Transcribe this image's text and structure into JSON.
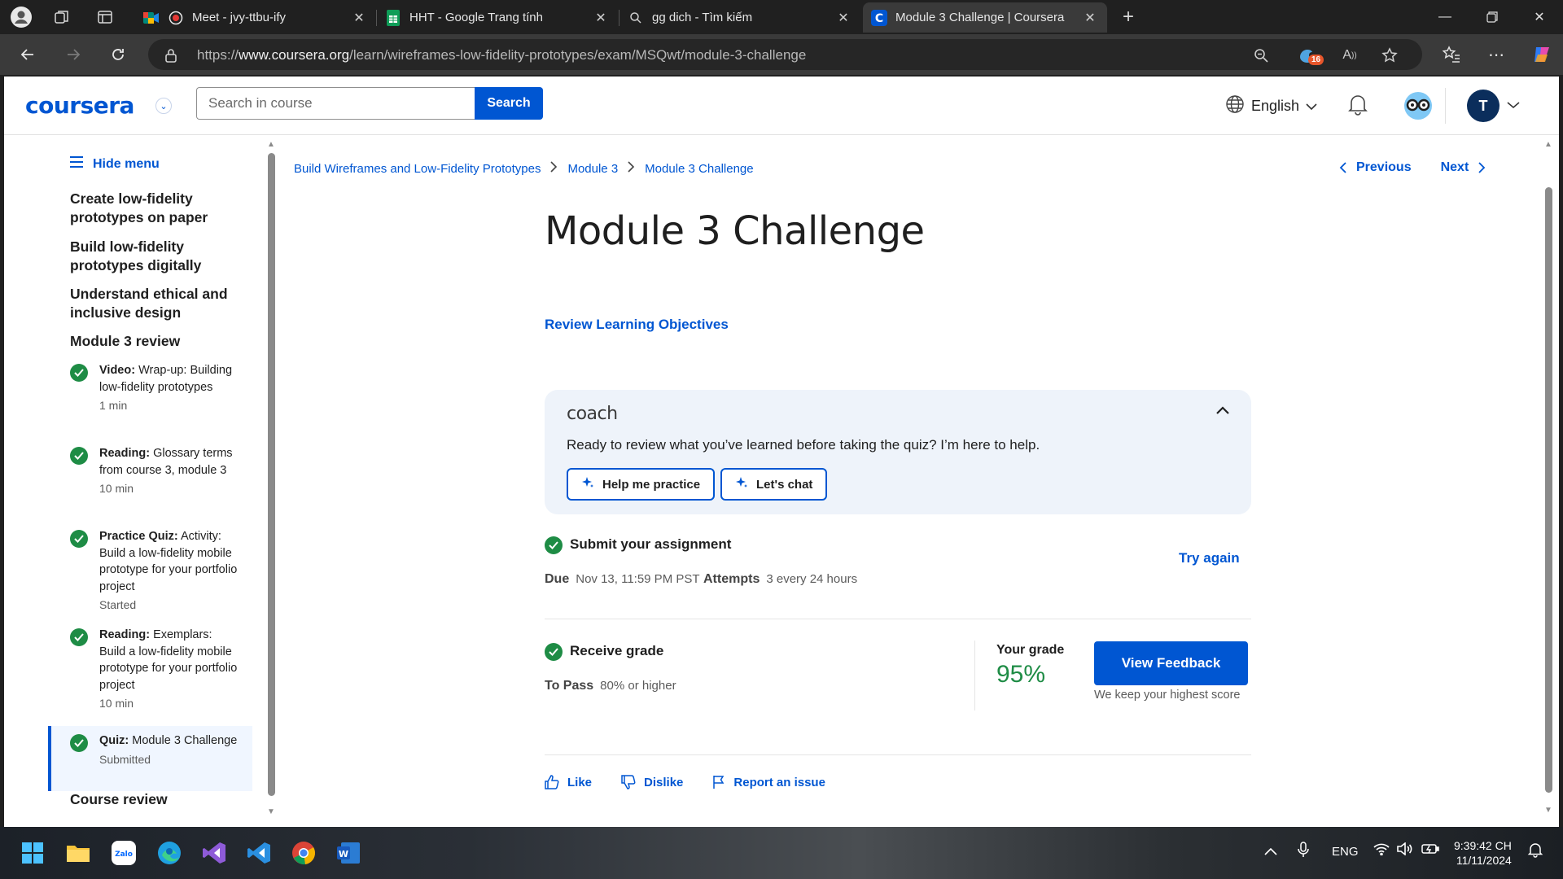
{
  "browser": {
    "tabs": [
      {
        "title": "Meet - jvy-ttbu-ify",
        "active": false
      },
      {
        "title": "HHT - Google Trang tính",
        "active": false
      },
      {
        "title": "gg dich - Tìm kiếm",
        "active": false
      },
      {
        "title": "Module 3 Challenge | Coursera",
        "active": true
      }
    ],
    "url_prefix": "https://",
    "url_domain": "www.coursera.org",
    "url_path": "/learn/wireframes-low-fidelity-prototypes/exam/MSQwt/module-3-challenge",
    "extension_badge": "16"
  },
  "header": {
    "logo": "coursera",
    "search_placeholder": "Search in course",
    "search_button": "Search",
    "language": "English",
    "avatar_initial": "T"
  },
  "sidebar": {
    "hide_menu": "Hide menu",
    "sections": [
      "Create low-fidelity prototypes on paper",
      "Build low-fidelity prototypes digitally",
      "Understand ethical and inclusive design",
      "Module 3 review"
    ],
    "items": [
      {
        "type": "Video:",
        "title": "Wrap-up: Building low-fidelity prototypes",
        "meta": "1 min"
      },
      {
        "type": "Reading:",
        "title": "Glossary terms from course 3, module 3",
        "meta": "10 min"
      },
      {
        "type": "Practice Quiz:",
        "title": "Activity: Build a low-fidelity mobile prototype for your portfolio project",
        "meta": "Started"
      },
      {
        "type": "Reading:",
        "title": "Exemplars: Build a low-fidelity mobile prototype for your portfolio project",
        "meta": "10 min"
      },
      {
        "type": "Quiz:",
        "title": "Module 3 Challenge",
        "meta": "Submitted"
      }
    ],
    "course_review": "Course review"
  },
  "breadcrumb": [
    "Build Wireframes and Low-Fidelity Prototypes",
    "Module 3",
    "Module 3 Challenge"
  ],
  "nav": {
    "previous": "Previous",
    "next": "Next"
  },
  "main": {
    "title": "Module 3 Challenge",
    "review_link": "Review Learning Objectives",
    "coach": {
      "logo": "coach",
      "message": "Ready to review what you’ve learned before taking the quiz? I’m here to help.",
      "btn_practice": "Help me practice",
      "btn_chat": "Let's chat"
    },
    "submit": {
      "title": "Submit your assignment",
      "due_label": "Due",
      "due_value": "Nov 13, 11:59 PM PST",
      "attempts_label": "Attempts",
      "attempts_value": "3 every 24 hours",
      "try_again": "Try again"
    },
    "grade": {
      "title": "Receive grade",
      "to_pass_label": "To Pass",
      "to_pass_value": "80% or higher",
      "your_grade_label": "Your grade",
      "your_grade_value": "95%",
      "view_feedback": "View Feedback",
      "note": "We keep your highest score"
    },
    "feedback": {
      "like": "Like",
      "dislike": "Dislike",
      "report": "Report an issue"
    }
  },
  "taskbar": {
    "lang": "ENG",
    "time": "9:39:42 CH",
    "date": "11/11/2024"
  },
  "colors": {
    "brand": "#0056d2",
    "success": "#1e8c45"
  }
}
